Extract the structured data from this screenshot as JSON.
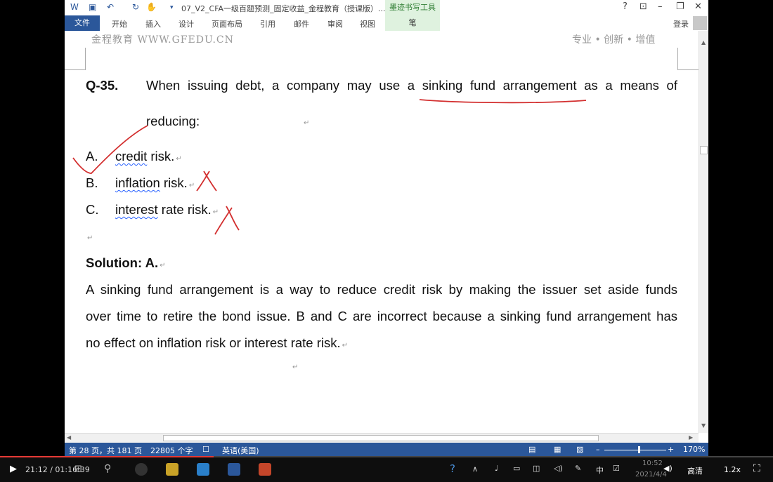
{
  "titlebar": {
    "doc_title": "07_V2_CFA一级百题预测_固定收益_金程教育（授课版）...",
    "ink_tools": "墨迹书写工具",
    "help": "?"
  },
  "ribbon": {
    "tabs": [
      "文件",
      "开始",
      "插入",
      "设计",
      "页面布局",
      "引用",
      "邮件",
      "审阅",
      "视图",
      "笔"
    ],
    "login": "登录"
  },
  "page_header": {
    "left": "金程教育 WWW.GFEDU.CN",
    "right": "专业 • 创新 • 增值"
  },
  "question": {
    "number": "Q-35.",
    "text_line1": "When issuing debt, a company may use a sinking fund arrangement as a means of",
    "text_line2": "reducing:",
    "options": [
      {
        "letter": "A.",
        "flagged": "credit",
        "rest": " risk."
      },
      {
        "letter": "B.",
        "flagged": "inflation",
        "rest": " risk."
      },
      {
        "letter": "C.",
        "flagged": "interest",
        "rest": " rate risk."
      }
    ]
  },
  "solution": {
    "heading": "Solution: A.",
    "line1": "A sinking fund arrangement is a way to reduce credit risk by making the issuer set aside funds",
    "line2": "over time to retire the bond issue. B and C are incorrect because a sinking fund arrangement has",
    "line3": "no effect on inflation risk or interest rate risk."
  },
  "statusbar": {
    "page": "第 28 页，共 181 页",
    "words": "22805 个字",
    "language": "英语(美国)",
    "zoom": "170%"
  },
  "player": {
    "time": "21:12 / 01:16:39",
    "clock_time": "10:52",
    "clock_date": "2021/4/4",
    "quality": "高清",
    "speed": "1.2x",
    "ime": "中",
    "progress_fraction": 0.276
  },
  "colors": {
    "word_blue": "#2b579a",
    "ink_red": "#d32f2f",
    "spell_blue": "#2962ff"
  }
}
